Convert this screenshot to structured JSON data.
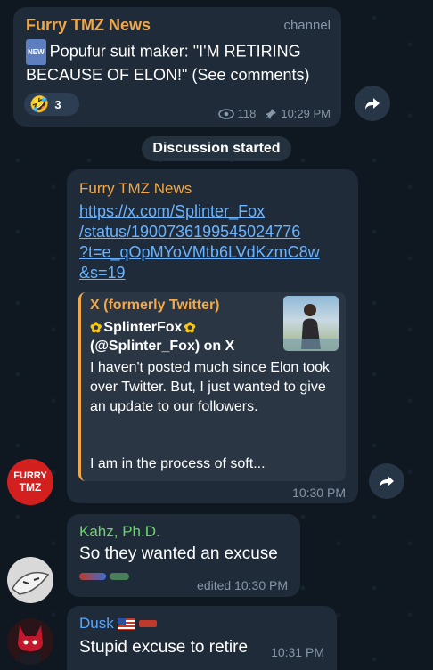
{
  "channel_post": {
    "source": "Furry TMZ News",
    "channel_label": "channel",
    "new_badge": "NEW",
    "text": "Popufur suit maker: \"I'M RETIRING BECAUSE OF ELON!\" (See comments)",
    "reaction_emoji": "🤣",
    "reaction_count": "3",
    "views": "118",
    "time": "10:29 PM"
  },
  "service_message": "Discussion started",
  "forward_post": {
    "author": "Furry TMZ News",
    "link_lines": [
      "https://x.com/Splinter_Fox",
      "/status/1900736199545024776",
      "?t=e_qOpMYoVMtb6LVdKzmC8w",
      "&s=19"
    ],
    "preview_site": "X (formerly Twitter)",
    "preview_name": "SplinterFox",
    "preview_handle": "(@Splinter_Fox) on X",
    "preview_text": "I haven't posted much since Elon took over Twitter. But, I just wanted to give an update to our followers.",
    "preview_text2": "I am in the process of soft...",
    "time": "10:30 PM",
    "avatar_text_1": "FURRY",
    "avatar_text_2": "TMZ"
  },
  "reply1": {
    "author": "Kahz, Ph.D.",
    "text": "So they wanted an excuse",
    "status": "edited 10:30 PM"
  },
  "reply2": {
    "author": "Dusk",
    "text": "Stupid excuse to retire",
    "time": "10:31 PM"
  }
}
